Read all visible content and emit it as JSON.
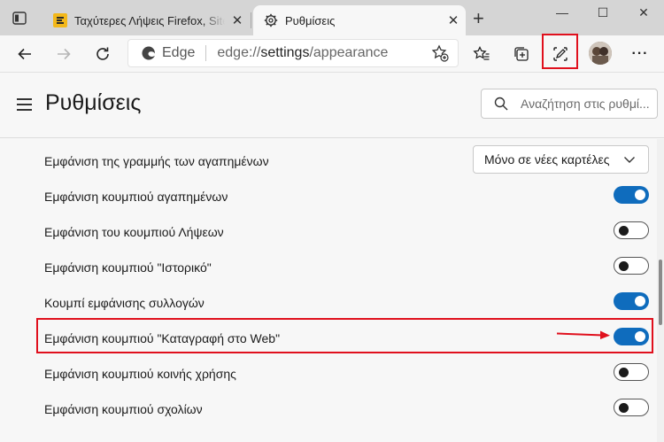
{
  "window": {
    "minimize": "—",
    "maximize": "☐",
    "close": "✕"
  },
  "tabs": [
    {
      "title": "Ταχύτερες Λήψεις Firefox, Site o",
      "active": false,
      "close": "✕"
    },
    {
      "title": "Ρυθμίσεις",
      "active": true,
      "close": "✕"
    }
  ],
  "new_tab": "+",
  "address_bar": {
    "brand": "Edge",
    "url_prefix": "edge://",
    "url_main": "settings",
    "url_suffix": "/appearance"
  },
  "toolbar": {
    "more_label": "···"
  },
  "settings": {
    "title": "Ρυθμίσεις",
    "search_placeholder": "Αναζήτηση στις ρυθμί..."
  },
  "rows": [
    {
      "label": "Εμφάνιση της γραμμής των αγαπημένων",
      "type": "dropdown",
      "value": "Μόνο σε νέες καρτέλες"
    },
    {
      "label": "Εμφάνιση κουμπιού αγαπημένων",
      "type": "toggle",
      "on": true
    },
    {
      "label": "Εμφάνιση του κουμπιού Λήψεων",
      "type": "toggle",
      "on": false
    },
    {
      "label": "Εμφάνιση κουμπιού \"Ιστορικό\"",
      "type": "toggle",
      "on": false
    },
    {
      "label": "Κουμπί εμφάνισης συλλογών",
      "type": "toggle",
      "on": true
    },
    {
      "label": "Εμφάνιση κουμπιού \"Καταγραφή στο Web\"",
      "type": "toggle",
      "on": true
    },
    {
      "label": "Εμφάνιση κουμπιού κοινής χρήσης",
      "type": "toggle",
      "on": false
    },
    {
      "label": "Εμφάνιση κουμπιού σχολίων",
      "type": "toggle",
      "on": false
    }
  ],
  "colors": {
    "accent": "#0f6cbd",
    "highlight": "#e0101d"
  }
}
